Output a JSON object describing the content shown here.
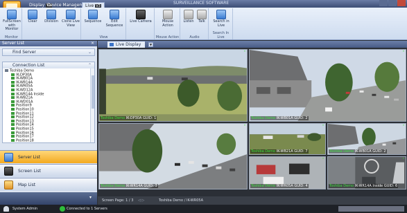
{
  "titlebar": {
    "title": "SURVEILLANCE SOFTWARE",
    "tabs": [
      {
        "label": "Display",
        "key": "V1"
      },
      {
        "label": "Device Management",
        "key": "V2"
      },
      {
        "label": "Live",
        "key": "V3"
      }
    ]
  },
  "ribbon": {
    "groups": [
      {
        "label": "Monitor",
        "buttons": [
          "FullScreen with Monitor"
        ]
      },
      {
        "label": "",
        "buttons": [
          "Clear",
          "Division",
          "Clone Live View"
        ]
      },
      {
        "label": "View",
        "buttons": [
          "Sequence",
          "Edit Sequence"
        ]
      },
      {
        "label": "",
        "buttons": [
          "Live Camera"
        ]
      },
      {
        "label": "Mouse Action",
        "buttons": [
          "Mouse Action"
        ]
      },
      {
        "label": "Audio",
        "buttons": [
          "Listen",
          "Talk"
        ]
      },
      {
        "label": "Search In Live",
        "buttons": [
          "Search in Live"
        ]
      }
    ]
  },
  "left_panel": {
    "title": "Server List",
    "find_server": "Find Server",
    "connection_list": "Connection List",
    "tree": [
      "Toshiba Demo",
      "IK-DP30A",
      "IK-WB01A",
      "IK-WR14A",
      "IK-WR05A",
      "IK-WD12A",
      "IK-WR14A Inside",
      "IK-WB21A",
      "IK-WD01A",
      "Position9",
      "Position10",
      "Position11",
      "Position12",
      "Position13",
      "Position14",
      "Position15",
      "Position16",
      "Position17",
      "Position18"
    ],
    "nav": [
      {
        "label": "Server List",
        "active": true
      },
      {
        "label": "Screen List",
        "active": false
      },
      {
        "label": "Map List",
        "active": false
      }
    ]
  },
  "main": {
    "tab_label": "Live Display",
    "tiles": [
      {
        "brand": "Toshiba Demo",
        "cam": "IK-DP30A GUID: 1"
      },
      {
        "brand": "Toshiba Demo",
        "cam": "IK-WB01A GUID: 2"
      },
      {
        "brand": "Toshiba Demo",
        "cam": "IK-WR14A GUID: 3"
      },
      {
        "brand": "Toshiba Demo",
        "cam": "IK-WB21A GUID: 7"
      },
      {
        "brand": "Toshiba Demo",
        "cam": "IK-WB01A GUID: 2"
      },
      {
        "brand": "Toshiba Demo",
        "cam": "IK-WR05A GUID: 4"
      },
      {
        "brand": "Toshiba Demo",
        "cam": "IK-WR14A Inside GUID: 6"
      }
    ],
    "rec_label": "\"",
    "page_text": "Screen Page: 1 / 3",
    "current": "Toshiba Demo / IK-WR05A"
  },
  "statusbar": {
    "user": "System Admin",
    "connection": "Connected to 1 Servers"
  },
  "colors": {
    "accent": "#f3a91f",
    "ribbon": "#cddbef",
    "live_green": "#3ee03e"
  }
}
